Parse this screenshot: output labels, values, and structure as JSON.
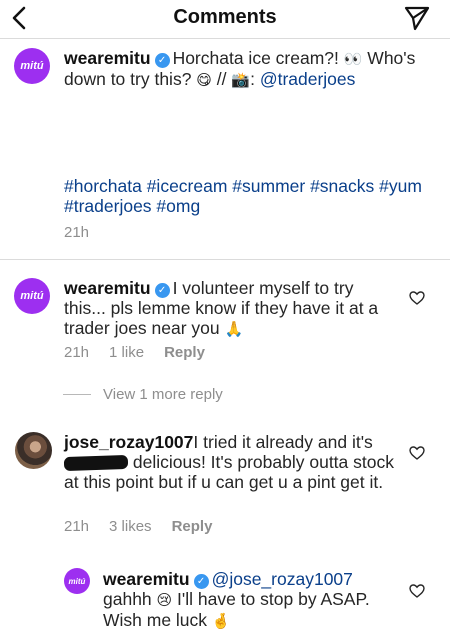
{
  "header": {
    "title": "Comments"
  },
  "caption": {
    "avatar_text": "mitú",
    "username": "wearemitu",
    "text_a": "Horchata ice cream?! ",
    "emoji_eyes": "👀",
    "text_b": " Who's down to try this? ",
    "emoji_smile": "😋",
    "text_c": " // ",
    "emoji_camera": "📸",
    "text_d": ": ",
    "mention": "@traderjoes",
    "hashtags_line1": "#horchata #icecream #summer #snacks #yum",
    "hashtags_line2": "#traderjoes #omg",
    "time": "21h"
  },
  "comments": [
    {
      "avatar_text": "mitú",
      "username": "wearemitu",
      "text": "I volunteer myself to try this... pls lemme know if they have it at a trader joes near you ",
      "emoji": "🙏",
      "time": "21h",
      "likes": "1 like",
      "reply": "Reply"
    },
    {
      "username": "jose_rozay1007",
      "text_a": "I tried it already and it's ",
      "text_b": " delicious! It's probably outta stock at this point but if u can get u a pint get it.",
      "time": "21h",
      "likes": "3 likes",
      "reply": "Reply"
    }
  ],
  "view_more": "View 1 more reply",
  "reply": {
    "avatar_text": "mitú",
    "username": "wearemitu",
    "mention": "@jose_rozay1007",
    "text_a": "gahhh ",
    "emoji_sad": "😢",
    "text_b": " I'll have to stop by ASAP. Wish me luck ",
    "emoji_fingers": "🤞"
  }
}
